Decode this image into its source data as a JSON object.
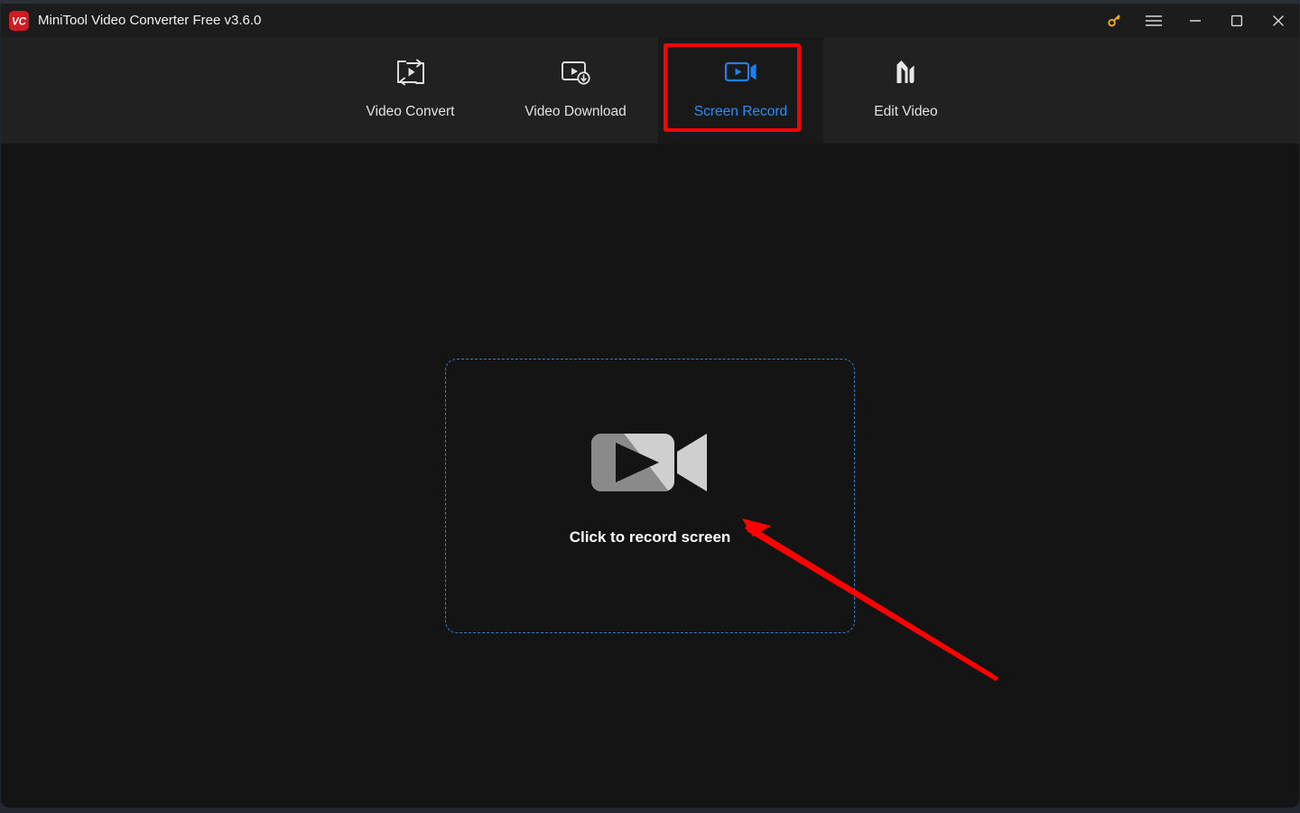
{
  "background": {
    "top_ghost_text": "                                       ",
    "bottom_ghost_text": "                                       "
  },
  "title_bar": {
    "logo_text": "VC",
    "title": "MiniTool Video Converter Free v3.6.0",
    "controls": [
      {
        "name": "key-icon",
        "label": "Register"
      },
      {
        "name": "hamburger-icon",
        "label": "Menu"
      },
      {
        "name": "minimize-icon",
        "label": "Minimize"
      },
      {
        "name": "maximize-icon",
        "label": "Maximize"
      },
      {
        "name": "close-icon",
        "label": "Close"
      }
    ]
  },
  "nav": {
    "tabs": [
      {
        "label": "Video Convert",
        "icon": "video-convert-icon",
        "active": false
      },
      {
        "label": "Video Download",
        "icon": "video-download-icon",
        "active": false
      },
      {
        "label": "Screen Record",
        "icon": "screen-record-icon",
        "active": true
      },
      {
        "label": "Edit Video",
        "icon": "edit-video-icon",
        "active": false
      }
    ],
    "active_color": "#2b8ef5",
    "inactive_color": "#e2e2e2"
  },
  "main": {
    "dropzone": {
      "hint": "Click to record screen",
      "icon": "video-camera-icon",
      "border_color": "#2f7fd8"
    }
  },
  "annotations": {
    "highlight_color": "#fe0000",
    "box_target": "Screen Record",
    "arrow_target": "Click to record screen"
  }
}
